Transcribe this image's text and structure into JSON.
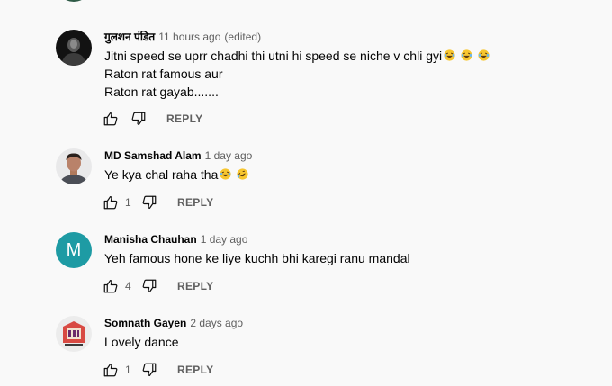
{
  "comments": [
    {
      "author": "गुलशन पंडित",
      "timestamp": "11 hours ago",
      "edited": "(edited)",
      "lines": [
        "Jitni speed se uprr chadhi thi utni hi speed se niche v chli gyi",
        "Raton rat famous aur",
        "Raton rat gayab......."
      ],
      "emojis": [
        "laughing-emoji",
        "laughing-emoji",
        "laughing-emoji"
      ],
      "likes": "",
      "reply_label": "REPLY"
    },
    {
      "author": "MD Samshad Alam",
      "timestamp": "1 day ago",
      "lines": [
        "Ye kya chal raha tha"
      ],
      "emojis": [
        "laughing-emoji",
        "rolling-laughing-emoji"
      ],
      "likes": "1",
      "reply_label": "REPLY"
    },
    {
      "author": "Manisha Chauhan",
      "timestamp": "1 day ago",
      "avatar_letter": "M",
      "lines": [
        "Yeh famous hone ke liye kuchh bhi karegi ranu mandal"
      ],
      "likes": "4",
      "reply_label": "REPLY"
    },
    {
      "author": "Somnath Gayen",
      "timestamp": "2 days ago",
      "lines": [
        "Lovely dance"
      ],
      "likes": "1",
      "reply_label": "REPLY"
    }
  ],
  "colors": {
    "background": "#f9f9f9",
    "author_text": "#030303",
    "meta_text": "#606060",
    "avatar_m": "#1e9ba4"
  },
  "icons": {
    "like": "thumbs-up-icon",
    "dislike": "thumbs-down-icon"
  }
}
